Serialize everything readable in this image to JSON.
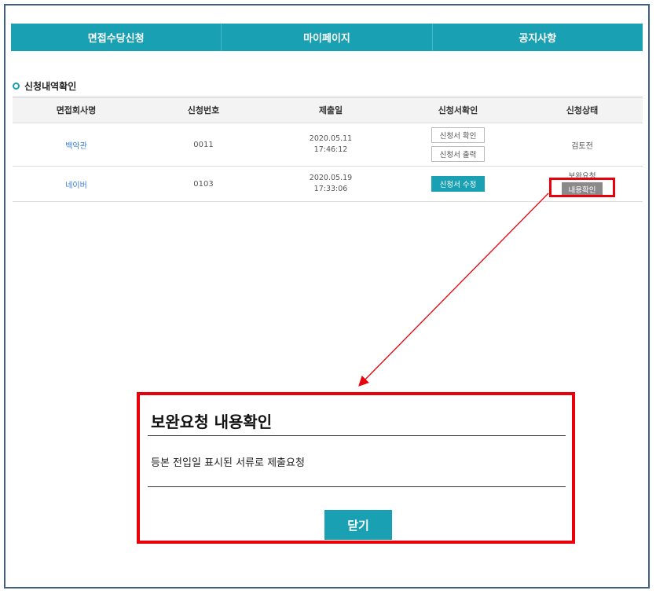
{
  "nav": {
    "items": [
      "면접수당신청",
      "마이페이지",
      "공지사항"
    ]
  },
  "section": {
    "title": "신청내역확인"
  },
  "table": {
    "headers": [
      "면접회사명",
      "신청번호",
      "제출일",
      "신청서확인",
      "신청상태"
    ],
    "rows": [
      {
        "company": "백악관",
        "number": "0011",
        "date": "2020.05.11",
        "time": "17:46:12",
        "buttons": [
          "신청서 확인",
          "신청서 출력"
        ],
        "status": "검토전"
      },
      {
        "company": "네이버",
        "number": "0103",
        "date": "2020.05.19",
        "time": "17:33:06",
        "buttons": [
          "신청서 수정"
        ],
        "status": "보완요청",
        "status_button": "내용확인"
      }
    ]
  },
  "modal": {
    "title": "보완요청 내용확인",
    "body": "등본 전입일 표시된 서류로 제출요청",
    "close_label": "닫기"
  },
  "colors": {
    "accent": "#1aa0b3",
    "highlight": "#e8000b",
    "frame": "#3f5f86"
  }
}
